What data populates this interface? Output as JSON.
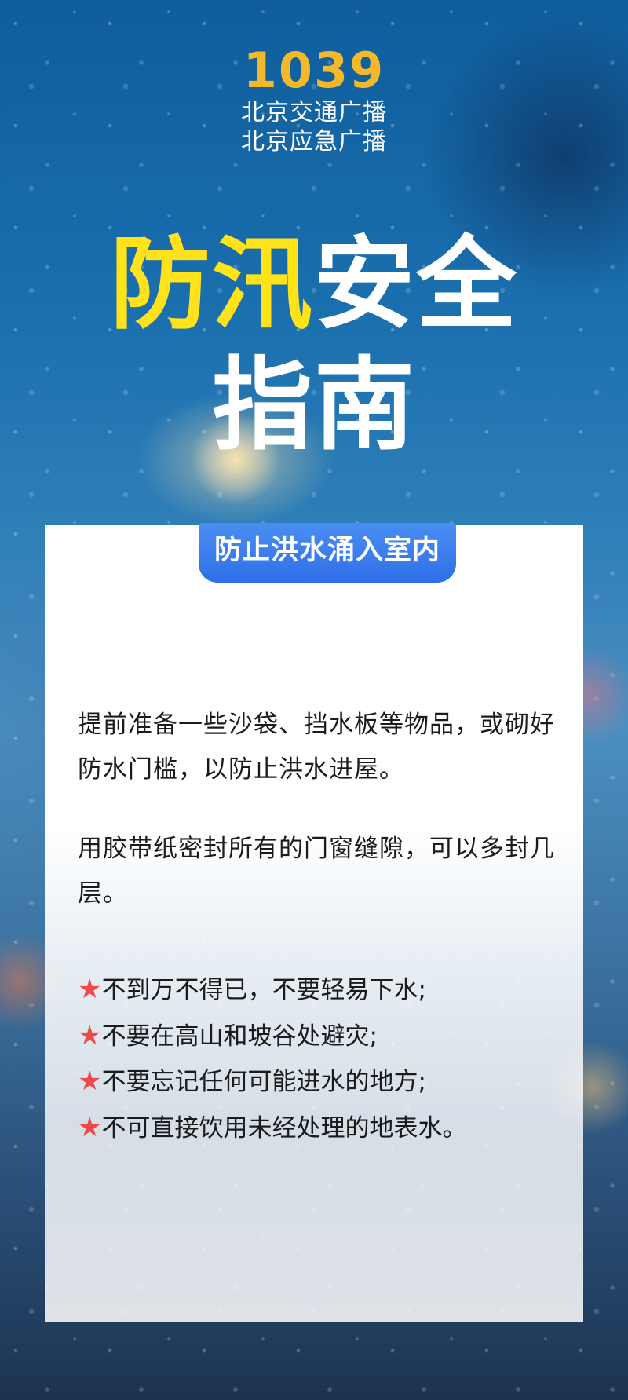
{
  "logo": {
    "number": "1039",
    "line1": "北京交通广播",
    "line2": "北京应急广播"
  },
  "title": {
    "part_yellow": "防汛",
    "part_white": "安全",
    "line2": "指南"
  },
  "card": {
    "tab_label": "防止洪水涌入室内",
    "paragraphs": [
      "提前准备一些沙袋、挡水板等物品，或砌好防水门槛，以防止洪水进屋。",
      "用胶带纸密封所有的门窗缝隙，可以多封几层。"
    ],
    "tips": [
      "不到万不得已，不要轻易下水;",
      "不要在高山和坡谷处避灾;",
      "不要忘记任何可能进水的地方;",
      "不可直接饮用未经处理的地表水。"
    ],
    "tip_marker": "★"
  },
  "colors": {
    "logo_yellow": "#f5b82a",
    "title_yellow": "#ffe21a",
    "tab_blue": "#2f6fe8",
    "star_red": "#ef4a4a"
  }
}
